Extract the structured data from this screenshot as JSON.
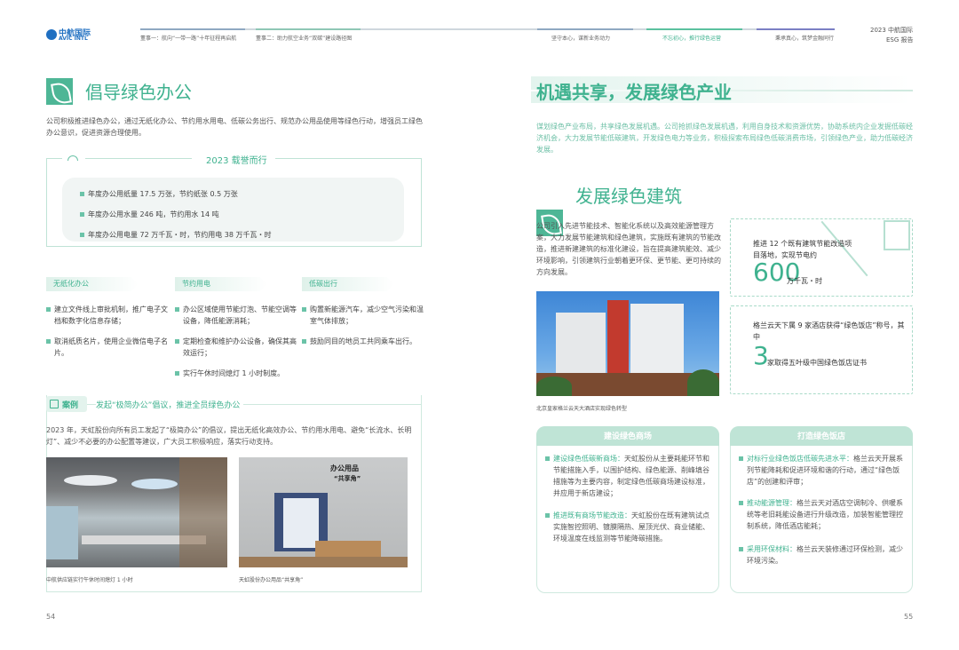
{
  "header": {
    "logo_cn": "中航国际",
    "logo_en": "AVIC INTL",
    "nav": [
      "董事一：航向“一带一路”十年征程再启航",
      "董事二：助力航空业务“双碳”建设路径图",
      "坚守本心，谋新业务动力",
      "不忘初心，推行绿色运营",
      "秉承真心，筑梦金融同行"
    ],
    "report_title": "2023 中航国际",
    "report_sub": "ESG 报告"
  },
  "left": {
    "title": "倡导绿色办公",
    "intro": "公司积极推进绿色办公，通过无纸化办公、节约用水用电、低碳公务出行、规范办公用品使用等绿色行动，增强员工绿色办公意识，促进资源合理使用。",
    "box_title": "2023 载誉而行",
    "stats": [
      "年度办公用纸量 17.5 万张，节约纸张 0.5 万张",
      "年度办公用水量 246 吨，节约用水 14 吨",
      "年度办公用电量 72 万千瓦・时，节约用电 38 万千瓦・时"
    ],
    "columns": [
      {
        "tag": "无纸化办公",
        "items": [
          "建立文件线上审批机制，推广电子文档和数字化信息存储；",
          "取消纸质名片，使用企业微信电子名片。"
        ]
      },
      {
        "tag": "节约用电",
        "items": [
          "办公区域使用节能灯泡、节能空调等设备，降低能源消耗；",
          "定期检查和维护办公设备，确保其高效运行；",
          "实行午休时间熄灯 1 小时制度。"
        ]
      },
      {
        "tag": "低碳出行",
        "items": [
          "购置新能源汽车，减少空气污染和温室气体排放；",
          "鼓励同目的地员工共同乘车出行。"
        ]
      }
    ],
    "case_label": "案例",
    "case_title": "发起“极简办公”倡议，推进全员绿色办公",
    "case_text": "2023 年，天虹股份向所有员工发起了“极简办公”的倡议，提出无纸化高效办公、节约用水用电、避免“长流水、长明灯”、减少不必要的办公配置等建议，广大员工积极响应，落实行动支持。",
    "photo1_caption": "中航供应链实行午休时间熄灯 1 小时",
    "photo2_caption": "天虹股份办公用品“共享角”",
    "photo2_sign": "办公用品",
    "photo2_sign2": "“共享角”",
    "page_no": "54"
  },
  "right": {
    "banner_title": "机遇共享，发展绿色产业",
    "banner_text": "谋划绿色产业布局，共享绿色发展机遇。公司抢抓绿色发展机遇，利用自身技术和资源优势，协助系统内企业发掘低碳经济机会，大力发展节能低碳建筑，开发绿色电力等业务，积极探索布局绿色低碳消费市场，引领绿色产业，助力低碳经济发展。",
    "section_title": "发展绿色建筑",
    "section_text": "公司引入先进节能技术、智能化系统以及高效能源管理方案，大力发展节能建筑和绿色建筑，实施既有建筑的节能改造，推进新建建筑的标准化建设，旨在提高建筑能效、减少环境影响，引领建筑行业朝着更环保、更节能、更可持续的方向发展。",
    "photo_caption": "北京皇家格兰云天大酒店实现绿色转型",
    "stat1_text": "推进 12 个既有建筑节能改造项目落地，实现节电约",
    "stat1_num": "600",
    "stat1_unit": "万千瓦・时",
    "stat2_text": "格兰云天下属 9 家酒店获得“绿色饭店”称号，其中",
    "stat2_num": "3",
    "stat2_unit": "家取得五叶级中国绿色饭店证书",
    "card1_title": "建设绿色商场",
    "card1_items": [
      {
        "head": "建设绿色低碳新商场：",
        "body": "天虹股份从主要耗能环节和节能措施入手，以围护结构、绿色能源、削峰填谷措施等为主要内容，制定绿色低碳商场建设标准，并应用于新店建设；"
      },
      {
        "head": "推进既有商场节能改造：",
        "body": "天虹股份在既有建筑试点实施智控照明、镀膜隔热、屋顶光伏、商业储能、环境温度在线监测等节能降碳措施。"
      }
    ],
    "card2_title": "打造绿色饭店",
    "card2_items": [
      {
        "head": "对标行业绿色饭店低碳先进水平：",
        "body": "格兰云天开展系列节能降耗和促进环境和谐的行动，通过“绿色饭店”的创建和评审；"
      },
      {
        "head": "推动能源管理：",
        "body": "格兰云天对酒店空调制冷、供暖系统等老旧耗能设备进行升级改造，加装智能管理控制系统，降低酒店能耗；"
      },
      {
        "head": "采用环保材料：",
        "body": "格兰云天装修通过环保检测，减少环境污染。"
      }
    ],
    "page_no": "55"
  },
  "colors": {
    "accent": "#3fb28f",
    "light": "#e6f4ef",
    "banner": "#eaf6f1"
  }
}
